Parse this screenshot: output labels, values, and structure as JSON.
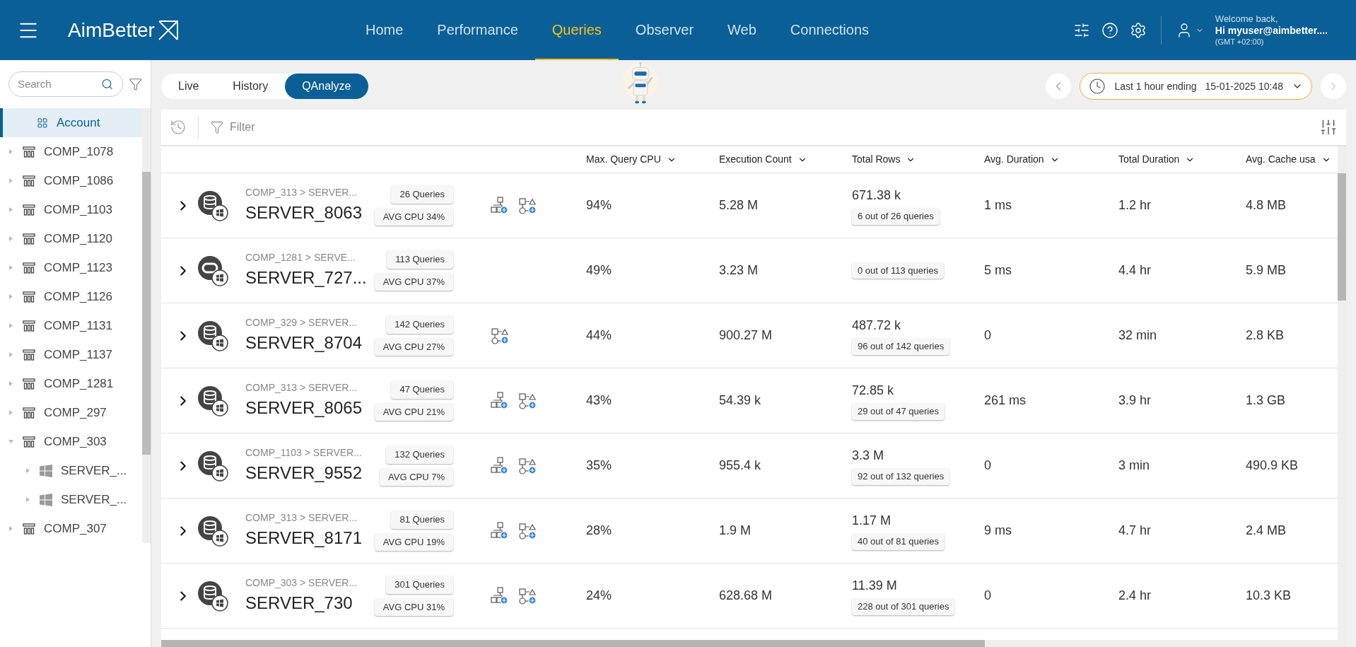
{
  "header": {
    "logo": "AimBetter",
    "nav": [
      {
        "label": "Home",
        "selected": false
      },
      {
        "label": "Performance",
        "selected": false
      },
      {
        "label": "Queries",
        "selected": true
      },
      {
        "label": "Observer",
        "selected": false
      },
      {
        "label": "Web",
        "selected": false
      },
      {
        "label": "Connections",
        "selected": false
      }
    ],
    "welcome": "Welcome back,",
    "user": "Hi myuser@aimbetter....",
    "timezone": "(GMT +02:00)"
  },
  "sidebar": {
    "search": {
      "placeholder": "Search"
    },
    "items": [
      {
        "kind": "account",
        "label": "Account",
        "selected": true
      },
      {
        "kind": "company",
        "label": "COMP_1078",
        "selected": false,
        "expanded": false
      },
      {
        "kind": "company",
        "label": "COMP_1086",
        "selected": false,
        "expanded": false
      },
      {
        "kind": "company",
        "label": "COMP_1103",
        "selected": false,
        "expanded": false
      },
      {
        "kind": "company",
        "label": "COMP_1120",
        "selected": false,
        "expanded": false
      },
      {
        "kind": "company",
        "label": "COMP_1123",
        "selected": false,
        "expanded": false
      },
      {
        "kind": "company",
        "label": "COMP_1126",
        "selected": false,
        "expanded": false
      },
      {
        "kind": "company",
        "label": "COMP_1131",
        "selected": false,
        "expanded": false
      },
      {
        "kind": "company",
        "label": "COMP_1137",
        "selected": false,
        "expanded": false
      },
      {
        "kind": "company",
        "label": "COMP_1281",
        "selected": false,
        "expanded": false
      },
      {
        "kind": "company",
        "label": "COMP_297",
        "selected": false,
        "expanded": false
      },
      {
        "kind": "company",
        "label": "COMP_303",
        "selected": false,
        "expanded": true,
        "children": [
          {
            "kind": "server",
            "label": "SERVER_...",
            "selected": false,
            "expanded": false
          },
          {
            "kind": "server",
            "label": "SERVER_...",
            "selected": false,
            "expanded": false
          }
        ]
      },
      {
        "kind": "company",
        "label": "COMP_307",
        "selected": false,
        "expanded": false
      }
    ]
  },
  "tabs": [
    {
      "label": "Live",
      "selected": false
    },
    {
      "label": "History",
      "selected": false
    },
    {
      "label": "QAnalyze",
      "selected": true
    }
  ],
  "time_range": {
    "label": "Last 1 hour ending",
    "date": "15-01-2025 10:48"
  },
  "filter": {
    "placeholder": "Filter"
  },
  "table": {
    "columns": [
      "Max. Query CPU",
      "Execution Count",
      "Total Rows",
      "Avg. Duration",
      "Total Duration",
      "Avg. Cache usa"
    ],
    "rows": [
      {
        "db": {
          "kind": "sql"
        },
        "path": "COMP_313 > SERVER...",
        "name": "SERVER_8063",
        "queries": "26 Queries",
        "avg_cpu": "AVG CPU 34%",
        "plan": {
          "kind": "double"
        },
        "max_cpu": "94%",
        "exec_count": "5.28 M",
        "total_rows": "671.38 k",
        "rows_badge": "6 out of 26 queries",
        "avg_duration": "1 ms",
        "total_duration": "1.2 hr",
        "avg_cache": "4.8 MB"
      },
      {
        "db": {
          "kind": "oracle"
        },
        "path": "COMP_1281 > SERVE...",
        "name": "SERVER_727...",
        "queries": "113 Queries",
        "avg_cpu": "AVG CPU 37%",
        "max_cpu": "49%",
        "exec_count": "3.23 M",
        "rows_badge": "0 out of 113 queries",
        "avg_duration": "5 ms",
        "total_duration": "4.4 hr",
        "avg_cache": "5.9 MB"
      },
      {
        "db": {
          "kind": "sql"
        },
        "path": "COMP_329 > SERVER...",
        "name": "SERVER_8704",
        "queries": "142 Queries",
        "avg_cpu": "AVG CPU 27%",
        "plan": {
          "kind": "single"
        },
        "max_cpu": "44%",
        "exec_count": "900.27 M",
        "total_rows": "487.72 k",
        "rows_badge": "96 out of 142 queries",
        "avg_duration": "0",
        "total_duration": "32 min",
        "avg_cache": "2.8 KB"
      },
      {
        "db": {
          "kind": "sql"
        },
        "path": "COMP_313 > SERVER...",
        "name": "SERVER_8065",
        "queries": "47 Queries",
        "avg_cpu": "AVG CPU 21%",
        "plan": {
          "kind": "double"
        },
        "max_cpu": "43%",
        "exec_count": "54.39 k",
        "total_rows": "72.85 k",
        "rows_badge": "29 out of 47 queries",
        "avg_duration": "261 ms",
        "total_duration": "3.9 hr",
        "avg_cache": "1.3 GB"
      },
      {
        "db": {
          "kind": "sql"
        },
        "path": "COMP_1103 > SERVER...",
        "name": "SERVER_9552",
        "queries": "132 Queries",
        "avg_cpu": "AVG CPU 7%",
        "plan": {
          "kind": "double"
        },
        "max_cpu": "35%",
        "exec_count": "955.4 k",
        "total_rows": "3.3 M",
        "rows_badge": "92 out of 132 queries",
        "avg_duration": "0",
        "total_duration": "3 min",
        "avg_cache": "490.9 KB"
      },
      {
        "db": {
          "kind": "sql"
        },
        "path": "COMP_313 > SERVER...",
        "name": "SERVER_8171",
        "queries": "81 Queries",
        "avg_cpu": "AVG CPU 19%",
        "plan": {
          "kind": "double"
        },
        "max_cpu": "28%",
        "exec_count": "1.9 M",
        "total_rows": "1.17 M",
        "rows_badge": "40 out of 81 queries",
        "avg_duration": "9 ms",
        "total_duration": "4.7 hr",
        "avg_cache": "2.4 MB"
      },
      {
        "db": {
          "kind": "sql"
        },
        "path": "COMP_303 > SERVER...",
        "name": "SERVER_730",
        "queries": "301 Queries",
        "avg_cpu": "AVG CPU 31%",
        "plan": {
          "kind": "double"
        },
        "max_cpu": "24%",
        "exec_count": "628.68 M",
        "total_rows": "11.39 M",
        "rows_badge": "228 out of 301 queries",
        "avg_duration": "0",
        "total_duration": "2.4 hr",
        "avg_cache": "10.3 KB"
      }
    ]
  }
}
